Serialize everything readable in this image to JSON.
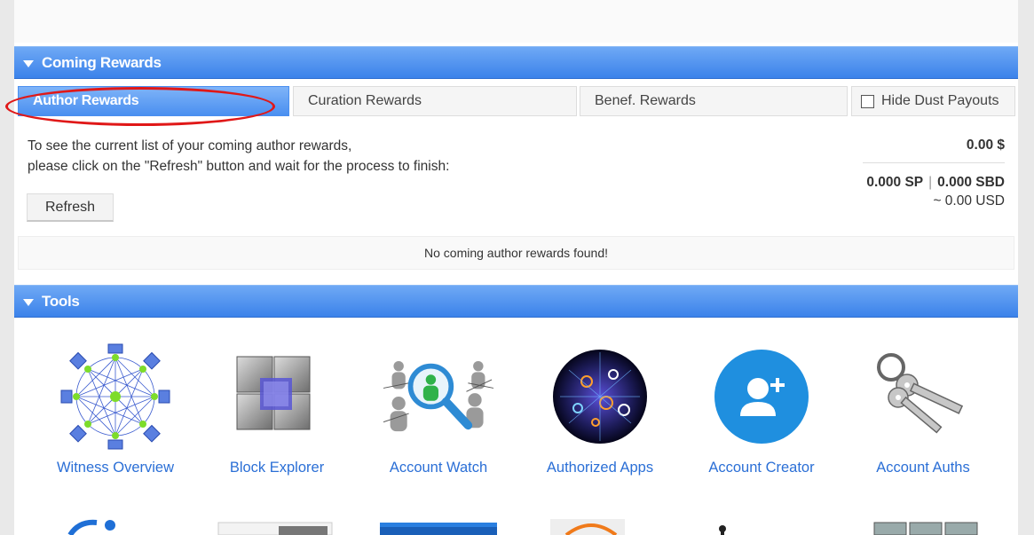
{
  "rewards": {
    "section_title": "Coming Rewards",
    "tabs": [
      {
        "label": "Author Rewards",
        "active": true
      },
      {
        "label": "Curation Rewards",
        "active": false
      },
      {
        "label": "Benef. Rewards",
        "active": false
      }
    ],
    "hide_dust_label": "Hide Dust Payouts",
    "instructions_line1": "To see the current list of your coming author rewards,",
    "instructions_line2": "please click on the \"Refresh\" button and wait for the process to finish:",
    "refresh_label": "Refresh",
    "total_usd": "0.00 $",
    "total_sp": "0.000 SP",
    "separator": "|",
    "total_sbd": "0.000 SBD",
    "total_approx": "~ 0.00 USD",
    "empty_message": "No coming author rewards found!"
  },
  "tools": {
    "section_title": "Tools",
    "items": [
      {
        "label": "Witness Overview",
        "icon": "network-icon"
      },
      {
        "label": "Block Explorer",
        "icon": "cube-icon"
      },
      {
        "label": "Account Watch",
        "icon": "magnifier-people-icon"
      },
      {
        "label": "Authorized Apps",
        "icon": "globe-icon"
      },
      {
        "label": "Account Creator",
        "icon": "add-user-icon"
      },
      {
        "label": "Account Auths",
        "icon": "keys-icon"
      }
    ]
  },
  "colors": {
    "accent_blue": "#3b82ea",
    "link_blue": "#2b6fd6",
    "highlight_red": "#e01818"
  }
}
